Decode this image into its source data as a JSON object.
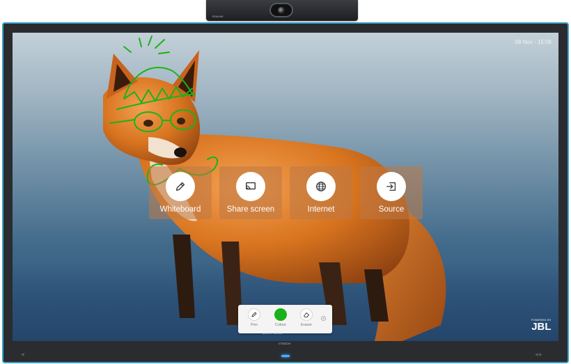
{
  "device": {
    "camera_brand": "YEALINK",
    "panel_brand": "CTOUCH",
    "led_color": "#44b4ff",
    "frame_accent": "#3aa3c9"
  },
  "screen": {
    "datetime": "08 Nov - 15:08",
    "background_image": "red fox standing in snow, doodled with green hat, glasses and moustache"
  },
  "tiles": [
    {
      "label": "Whiteboard",
      "icon": "pencil-icon"
    },
    {
      "label": "Share screen",
      "icon": "cast-icon"
    },
    {
      "label": "Internet",
      "icon": "globe-icon"
    },
    {
      "label": "Source",
      "icon": "input-source-icon"
    }
  ],
  "toolbar": {
    "pen_label": "Pen",
    "colour_label": "Colour",
    "eraser_label": "Eraser",
    "active_colour": "#19b319",
    "settings_icon": "gear-icon",
    "caption": "QUICK MENU"
  },
  "branding": {
    "powered_by": "POWERED BY",
    "logo": "JBL"
  },
  "colors": {
    "annotation_green": "#19b319",
    "tile_bg": "rgba(190,120,70,0.55)"
  }
}
